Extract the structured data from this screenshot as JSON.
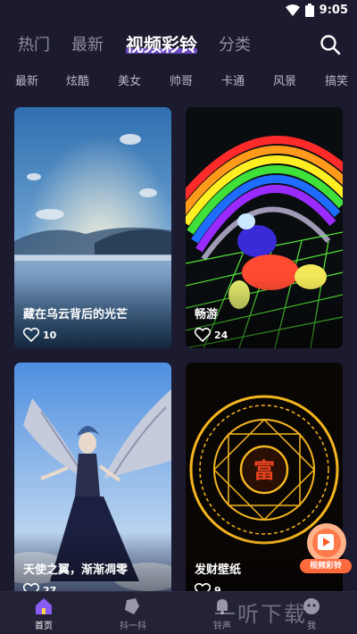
{
  "status_bar": {
    "time": "9:05"
  },
  "top_tabs": [
    "热门",
    "最新",
    "视频彩铃",
    "分类"
  ],
  "sub_tabs": [
    "最新",
    "炫酷",
    "美女",
    "帅哥",
    "卡通",
    "风景",
    "搞笑"
  ],
  "cards": [
    {
      "title": "藏在乌云背后的光芒",
      "likes": "10"
    },
    {
      "title": "畅游",
      "likes": "24"
    },
    {
      "title": "天使之翼，渐渐凋零",
      "likes": "27"
    },
    {
      "title": "发财壁纸",
      "likes": "9"
    }
  ],
  "cards_extra": {
    "seal_char": "富"
  },
  "float_badge": {
    "label": "视频彩铃"
  },
  "bottom_nav": [
    "首页",
    "抖一抖",
    "铃声",
    "我"
  ],
  "watermark": "一听下载",
  "colors": {
    "background": "#1b1a2e",
    "accent": "#8a5cf6",
    "nav_bg": "#232236"
  }
}
